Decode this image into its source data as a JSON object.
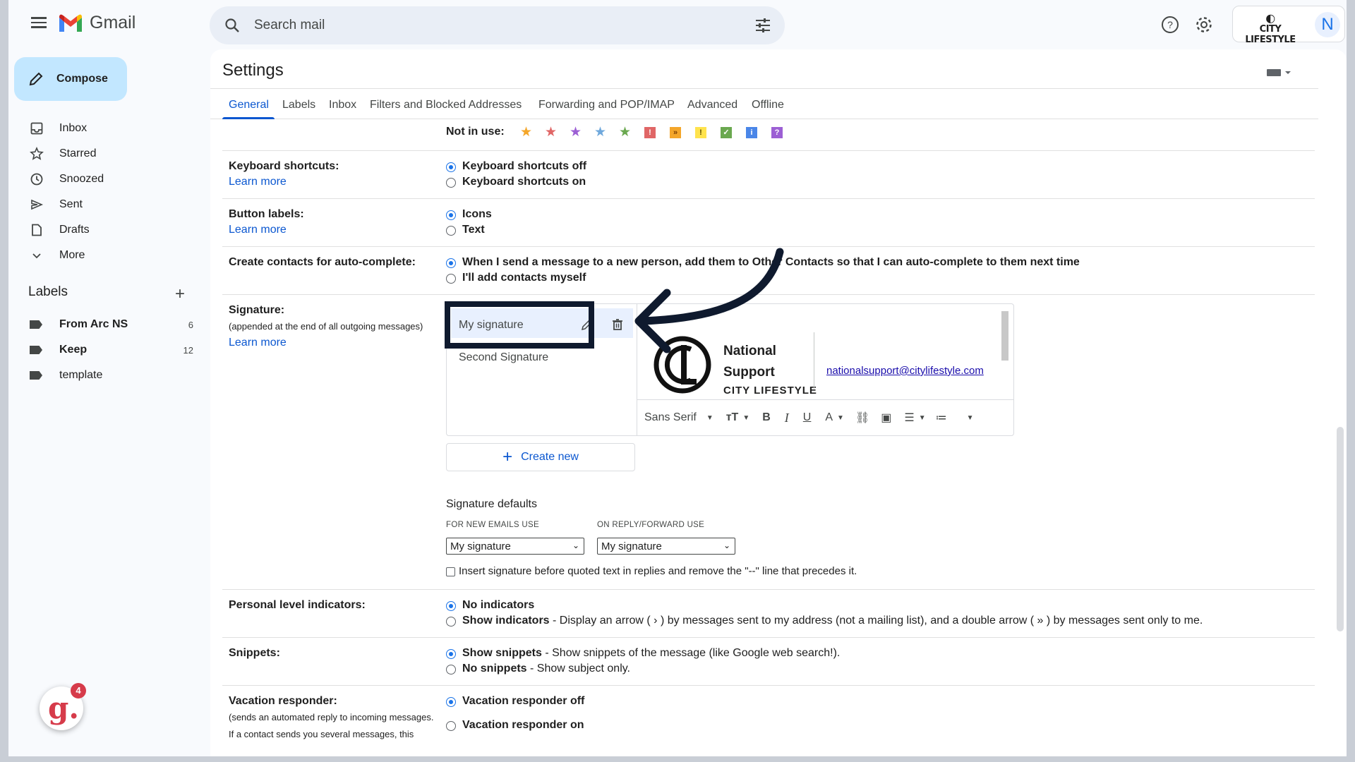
{
  "app": {
    "name": "Gmail"
  },
  "search": {
    "placeholder": "Search mail"
  },
  "account": {
    "brand": "CITY LIFESTYLE",
    "avatar_letter": "N"
  },
  "sidebar": {
    "compose": "Compose",
    "items": [
      {
        "label": "Inbox",
        "icon": "inbox-icon"
      },
      {
        "label": "Starred",
        "icon": "star-icon"
      },
      {
        "label": "Snoozed",
        "icon": "clock-icon"
      },
      {
        "label": "Sent",
        "icon": "send-icon"
      },
      {
        "label": "Drafts",
        "icon": "draft-icon"
      },
      {
        "label": "More",
        "icon": "chevron-down-icon"
      }
    ],
    "labels_heading": "Labels",
    "labels": [
      {
        "label": "From Arc NS",
        "count": "6"
      },
      {
        "label": "Keep",
        "count": "12"
      },
      {
        "label": "template",
        "count": ""
      }
    ]
  },
  "settings": {
    "title": "Settings",
    "tabs": [
      "General",
      "Labels",
      "Inbox",
      "Filters and Blocked Addresses",
      "Forwarding and POP/IMAP",
      "Advanced",
      "Offline"
    ],
    "active_tab": "General",
    "not_in_use_label": "Not in use:",
    "learn_more": "Learn more",
    "keyboard": {
      "label": "Keyboard shortcuts:",
      "options": [
        "Keyboard shortcuts off",
        "Keyboard shortcuts on"
      ],
      "selected": 0
    },
    "button_labels": {
      "label": "Button labels:",
      "options": [
        "Icons",
        "Text"
      ],
      "selected": 0
    },
    "contacts": {
      "label": "Create contacts for auto-complete:",
      "options": [
        "When I send a message to a new person, add them to Other Contacts so that I can auto-complete to them next time",
        "I'll add contacts myself"
      ],
      "selected": 0
    },
    "signature": {
      "label": "Signature:",
      "sublabel": "(appended at the end of all outgoing messages)",
      "items": [
        "My signature",
        "Second Signature"
      ],
      "preview_name_line1": "National",
      "preview_name_line2": "Support",
      "preview_brand": "CITY LIFESTYLE",
      "preview_email": "nationalsupport@citylifestyle.com",
      "toolbar_font": "Sans Serif",
      "create_new": "Create new",
      "defaults_title": "Signature defaults",
      "new_emails_caption": "FOR NEW EMAILS USE",
      "reply_caption": "ON REPLY/FORWARD USE",
      "new_emails_value": "My signature",
      "reply_value": "My signature",
      "insert_before_text": "Insert signature before quoted text in replies and remove the \"--\" line that precedes it."
    },
    "personal_indicators": {
      "label": "Personal level indicators:",
      "opt1_bold": "No indicators",
      "opt2_bold": "Show indicators",
      "opt2_rest": " - Display an arrow ( › ) by messages sent to my address (not a mailing list), and a double arrow ( » ) by messages sent only to me.",
      "selected": 0
    },
    "snippets": {
      "label": "Snippets:",
      "opt1_bold": "Show snippets",
      "opt1_rest": " - Show snippets of the message (like Google web search!).",
      "opt2_bold": "No snippets",
      "opt2_rest": " - Show subject only.",
      "selected": 0
    },
    "vacation": {
      "label": "Vacation responder:",
      "sub1": "(sends an automated reply to incoming messages.",
      "sub2": "If a contact sends you several messages, this",
      "options": [
        "Vacation responder off",
        "Vacation responder on"
      ],
      "selected": 0
    }
  },
  "extension": {
    "badge": "4"
  },
  "colors": {
    "accent": "#0b57d0",
    "compose_bg": "#c2e7ff",
    "highlight_box": "#0f1a2e"
  }
}
